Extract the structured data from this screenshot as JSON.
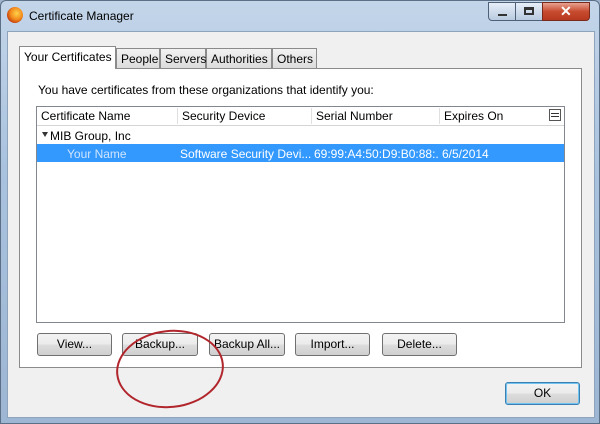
{
  "window": {
    "title": "Certificate Manager",
    "icon": "firefox-icon",
    "controls": {
      "minimize": "minimize-icon",
      "maximize": "maximize-icon",
      "close": "✕"
    }
  },
  "tabs": [
    {
      "label": "Your Certificates",
      "active": true
    },
    {
      "label": "People",
      "active": false
    },
    {
      "label": "Servers",
      "active": false
    },
    {
      "label": "Authorities",
      "active": false
    },
    {
      "label": "Others",
      "active": false
    }
  ],
  "intro_text": "You have certificates from these organizations that identify you:",
  "table": {
    "columns": [
      "Certificate Name",
      "Security Device",
      "Serial Number",
      "Expires On"
    ],
    "groups": [
      {
        "name": "MIB Group, Inc",
        "rows": [
          {
            "name": "Your Name",
            "device": "Software Security Devi...",
            "serial": "69:99:A4:50:D9:B0:88:...",
            "expires": "6/5/2014",
            "selected": true
          }
        ]
      }
    ]
  },
  "buttons": {
    "view": "View...",
    "backup": "Backup...",
    "backup_all": "Backup All...",
    "import": "Import...",
    "delete": "Delete...",
    "ok": "OK"
  },
  "colors": {
    "selection": "#3399ff",
    "annotation": "#b1262c"
  }
}
